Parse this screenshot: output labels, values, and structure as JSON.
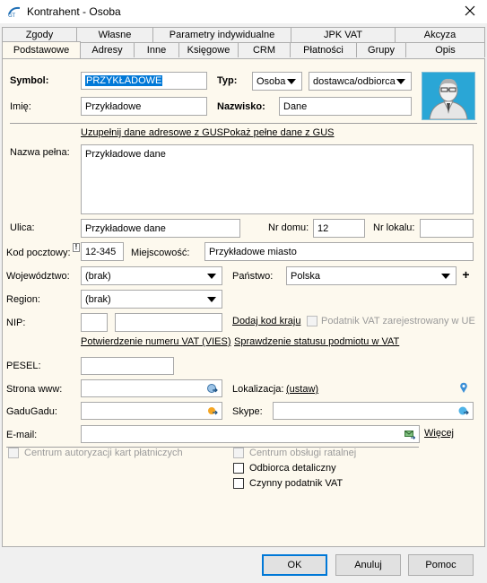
{
  "window": {
    "title": "Kontrahent - Osoba"
  },
  "tabs": {
    "row1": [
      "Zgody",
      "Własne",
      "Parametry indywidualne",
      "JPK VAT",
      "Akcyza"
    ],
    "row2": [
      "Podstawowe",
      "Adresy",
      "Inne",
      "Księgowe",
      "CRM",
      "Płatności",
      "Grupy",
      "Opis"
    ]
  },
  "form": {
    "symbol_label": "Symbol:",
    "symbol_value": "PRZYKŁADOWE",
    "typ_label": "Typ:",
    "typ_value": "Osoba",
    "typ2_value": "dostawca/odbiorca",
    "imie_label": "Imię:",
    "imie_value": "Przykładowe",
    "nazwisko_label": "Nazwisko:",
    "nazwisko_value": "Dane",
    "gus_link1": "Uzupełnij dane adresowe z GUS",
    "gus_link2": "Pokaż pełne dane z GUS",
    "nazwa_label": "Nazwa pełna:",
    "nazwa_value": "Przykładowe dane",
    "ulica_label": "Ulica:",
    "ulica_value": "Przykładowe dane",
    "nrdomu_label": "Nr domu:",
    "nrdomu_value": "12",
    "nrlokalu_label": "Nr lokalu:",
    "nrlokalu_value": "",
    "kod_label": "Kod pocztowy:",
    "kod_warn": "!",
    "kod_value": "12-345",
    "miejsc_label": "Miejscowość:",
    "miejsc_value": "Przykładowe miasto",
    "woj_label": "Województwo:",
    "woj_value": "(brak)",
    "panstwo_label": "Państwo:",
    "panstwo_value": "Polska",
    "plus": "+",
    "region_label": "Region:",
    "region_value": "(brak)",
    "nip_label": "NIP:",
    "nip_prefix": "",
    "nip_value": "",
    "dodaj_kod": "Dodaj kod kraju",
    "podatnik_ue": "Podatnik VAT zarejestrowany w UE",
    "vies_link": "Potwierdzenie numeru VAT (VIES)",
    "status_link": "Sprawdzenie statusu podmiotu w VAT",
    "pesel_label": "PESEL:",
    "pesel_value": "",
    "www_label": "Strona www:",
    "www_value": "",
    "lokal_label": "Lokalizacja:",
    "lokal_link": "(ustaw)",
    "gadu_label": "GaduGadu:",
    "gadu_value": "",
    "skype_label": "Skype:",
    "skype_value": "",
    "email_label": "E-mail:",
    "email_value": "",
    "wiecej_link": "Więcej",
    "cb_centrum_kart": "Centrum autoryzacji kart płatniczych",
    "cb_centrum_ratalnej": "Centrum obsługi ratalnej",
    "cb_odbiorca": "Odbiorca detaliczny",
    "cb_czynny": "Czynny podatnik VAT"
  },
  "buttons": {
    "ok": "OK",
    "cancel": "Anuluj",
    "help": "Pomoc"
  },
  "colors": {
    "panel": "#fdf9ee",
    "selection": "#0078d7",
    "avatar_bg": "#2aa6d6"
  }
}
